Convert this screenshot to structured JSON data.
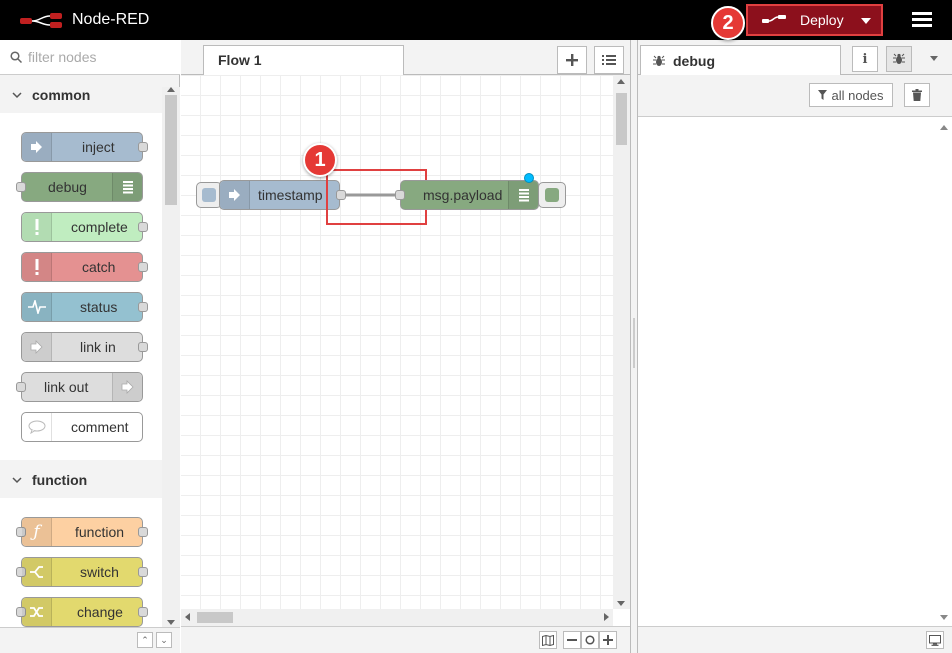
{
  "app": {
    "title": "Node-RED"
  },
  "header": {
    "deploy_label": "Deploy"
  },
  "callouts": {
    "one": "1",
    "two": "2"
  },
  "palette": {
    "search_placeholder": "filter nodes",
    "categories": [
      {
        "label": "common",
        "nodes": [
          {
            "label": "inject",
            "color": "#a6bbcf"
          },
          {
            "label": "debug",
            "color": "#87a980"
          },
          {
            "label": "complete",
            "color": "#c0edc0"
          },
          {
            "label": "catch",
            "color": "#e49191"
          },
          {
            "label": "status",
            "color": "#94c1d0"
          },
          {
            "label": "link in",
            "color": "#dddddd"
          },
          {
            "label": "link out",
            "color": "#dddddd"
          },
          {
            "label": "comment",
            "color": "#ffffff"
          }
        ]
      },
      {
        "label": "function",
        "nodes": [
          {
            "label": "function",
            "color": "#fdd0a2"
          },
          {
            "label": "switch",
            "color": "#e2d96e"
          },
          {
            "label": "change",
            "color": "#e2d96e"
          }
        ]
      }
    ]
  },
  "workspace": {
    "tab_label": "Flow 1",
    "nodes": [
      {
        "label": "timestamp",
        "color": "#a6bbcf"
      },
      {
        "label": "msg.payload",
        "color": "#87a980"
      }
    ]
  },
  "sidebar": {
    "tab_label": "debug",
    "filter_label": "all nodes"
  },
  "colors": {
    "deploy_bg": "#8c101c",
    "highlight": "#e04040",
    "callout": "#e53935",
    "changed_dot": "#00bcff"
  }
}
